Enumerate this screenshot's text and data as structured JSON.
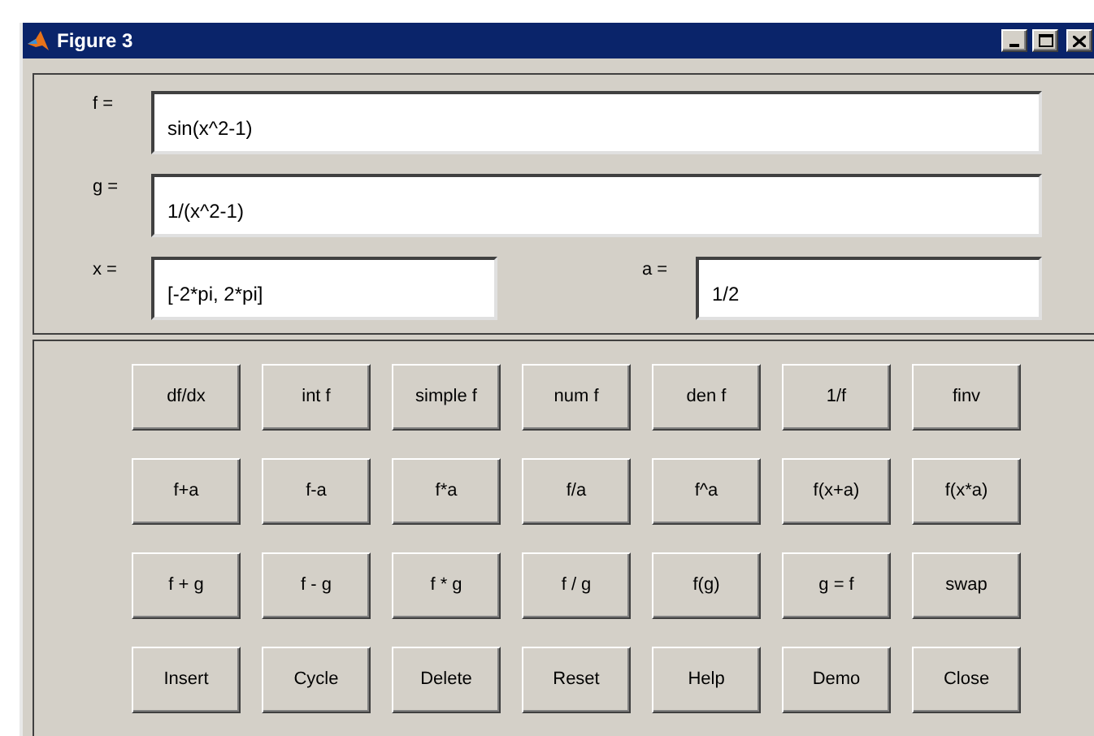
{
  "window": {
    "title": "Figure 3"
  },
  "fields": [
    {
      "label": "f =",
      "value": "sin(x^2-1)"
    },
    {
      "label": "g =",
      "value": "1/(x^2-1)"
    }
  ],
  "small_fields": [
    {
      "label": "x =",
      "value": "[-2*pi, 2*pi]"
    },
    {
      "label": "a =",
      "value": "1/2"
    }
  ],
  "button_rows": [
    [
      "df/dx",
      "int f",
      "simple f",
      "num f",
      "den f",
      "1/f",
      "finv"
    ],
    [
      "f+a",
      "f-a",
      "f*a",
      "f/a",
      "f^a",
      "f(x+a)",
      "f(x*a)"
    ],
    [
      "f + g",
      "f - g",
      "f * g",
      "f / g",
      "f(g)",
      "g = f",
      "swap"
    ],
    [
      "Insert",
      "Cycle",
      "Delete",
      "Reset",
      "Help",
      "Demo",
      "Close"
    ]
  ]
}
